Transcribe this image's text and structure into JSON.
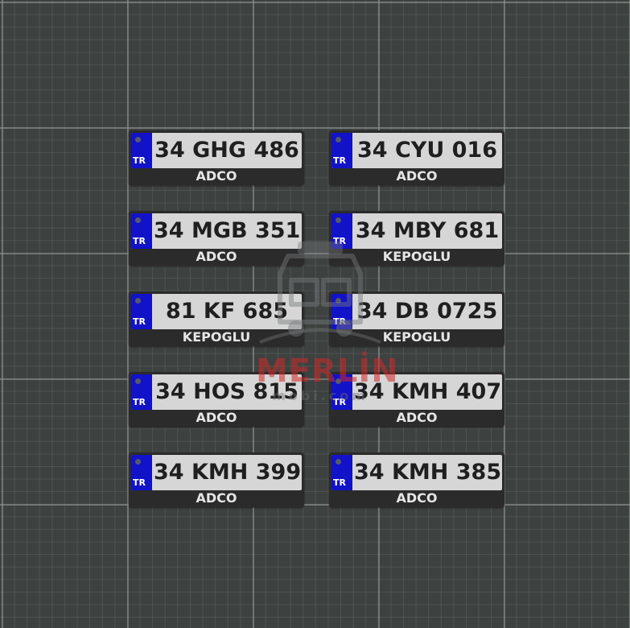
{
  "plates": [
    {
      "country": "TR",
      "number": "34 GHG 486",
      "dealer": "ADCO"
    },
    {
      "country": "TR",
      "number": "34 CYU 016",
      "dealer": "ADCO"
    },
    {
      "country": "TR",
      "number": "34 MGB 351",
      "dealer": "ADCO"
    },
    {
      "country": "TR",
      "number": "34 MBY 681",
      "dealer": "KEPOGLU"
    },
    {
      "country": "TR",
      "number": "81 KF 685",
      "dealer": "KEPOGLU"
    },
    {
      "country": "TR",
      "number": "34 DB 0725",
      "dealer": "KEPOGLU"
    },
    {
      "country": "TR",
      "number": "34 HOS 815",
      "dealer": "ADCO"
    },
    {
      "country": "TR",
      "number": "34 KMH 407",
      "dealer": "ADCO"
    },
    {
      "country": "TR",
      "number": "34 KMH 399",
      "dealer": "ADCO"
    },
    {
      "country": "TR",
      "number": "34 KMH 385",
      "dealer": "ADCO"
    }
  ],
  "watermark": {
    "brand": "MERLİN",
    "subtitle": "mobi.com"
  },
  "colors": {
    "euro_band": "#1212c8",
    "plate_face": "#d6d6d6",
    "plate_frame": "#2b2b2b",
    "canvas_background": "#3d4240",
    "watermark_brand": "#d22828"
  }
}
